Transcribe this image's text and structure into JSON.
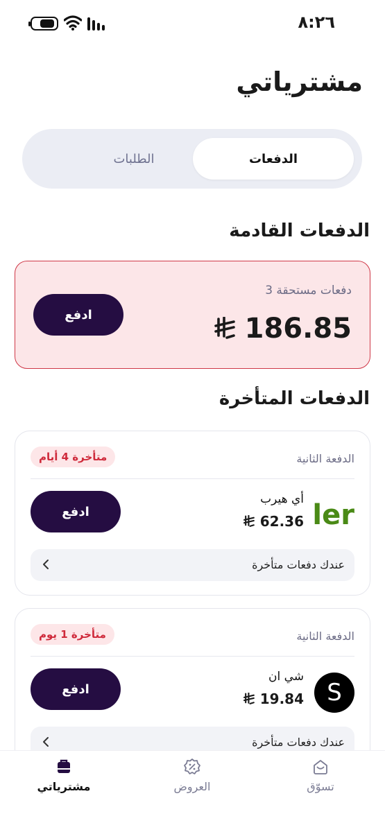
{
  "status_bar": {
    "time": "٨:٢٦"
  },
  "header": {
    "title": "مشترياتي"
  },
  "tabs": {
    "active_label": "الدفعات",
    "inactive_label": "الطلبات"
  },
  "upcoming": {
    "section_title": "الدفعات القادمة",
    "count_label": "3 دفعات مستحقة",
    "amount": "186.85",
    "pay_label": "ادفع"
  },
  "overdue": {
    "section_title": "الدفعات المتأخرة",
    "cards": [
      {
        "installment_label": "الدفعة الثانية",
        "late_badge": "متأخرة 4 أيام",
        "merchant_name": "أي هيرب",
        "logo_text": "ler",
        "amount": "62.36",
        "pay_label": "ادفع",
        "row_label": "عندك دفعات متأخرة"
      },
      {
        "installment_label": "الدفعة الثانية",
        "late_badge": "متأخرة 1 يوم",
        "merchant_name": "شي ان",
        "logo_text": "S",
        "amount": "19.84",
        "pay_label": "ادفع",
        "row_label": "عندك دفعات متأخرة"
      }
    ]
  },
  "bottom_nav": {
    "items": [
      {
        "label": "مشترياتي",
        "icon": "bag-icon",
        "active": true
      },
      {
        "label": "العروض",
        "icon": "discount-icon",
        "active": false
      },
      {
        "label": "تسوّق",
        "icon": "shop-icon",
        "active": false
      }
    ]
  },
  "colors": {
    "primary": "#250d42",
    "danger": "#cf2a3b",
    "upcoming_bg": "#fce6e8",
    "iherb_green": "#4a8a16"
  }
}
